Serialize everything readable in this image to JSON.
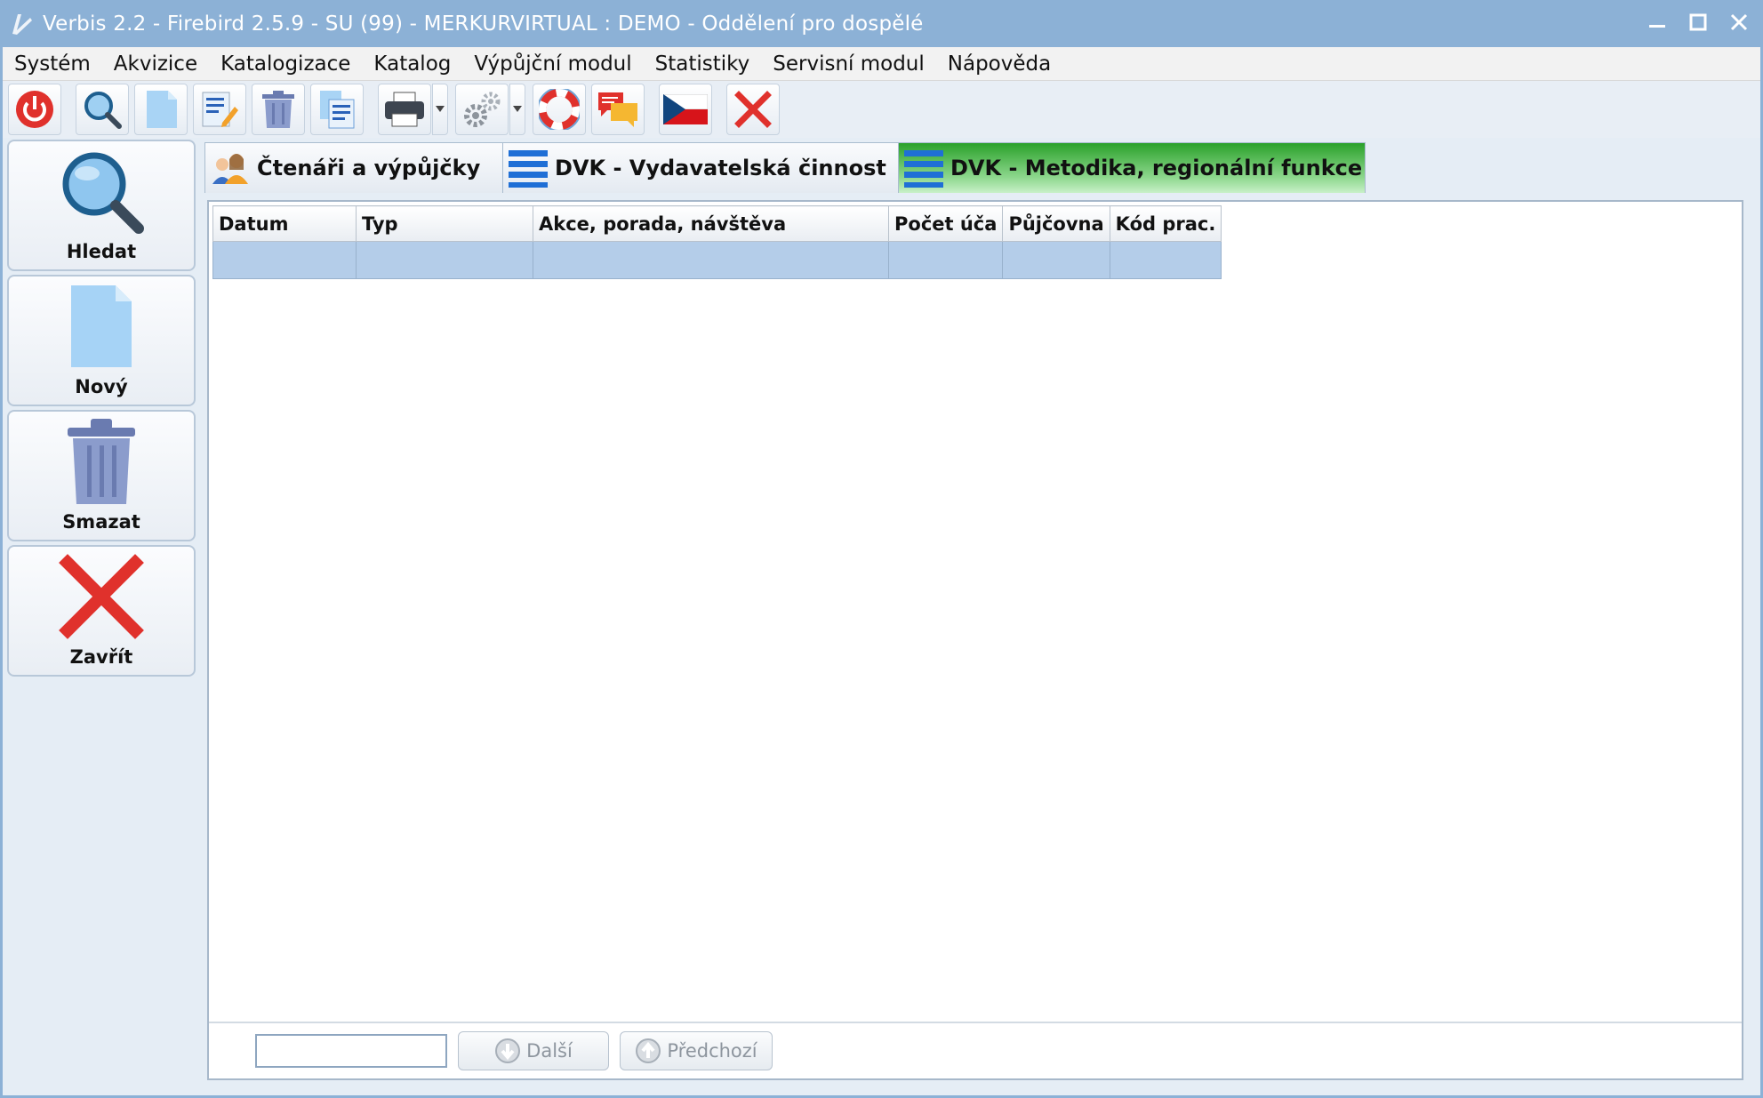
{
  "window": {
    "title": "Verbis 2.2 - Firebird 2.5.9 - SU (99) - MERKURVIRTUAL : DEMO - Oddělení pro dospělé"
  },
  "menu": {
    "items": [
      "Systém",
      "Akvizice",
      "Katalogizace",
      "Katalog",
      "Výpůjční modul",
      "Statistiky",
      "Servisní modul",
      "Nápověda"
    ]
  },
  "toolbar": {
    "icons": [
      "power-icon",
      "search-icon",
      "new-document-icon",
      "edit-document-icon",
      "trash-icon",
      "copy-document-icon",
      "printer-icon",
      "settings-gears-icon",
      "lifebuoy-icon",
      "chat-bubbles-icon",
      "czech-flag-icon",
      "close-icon"
    ]
  },
  "sidebar": {
    "items": [
      {
        "label": "Hledat"
      },
      {
        "label": "Nový"
      },
      {
        "label": "Smazat"
      },
      {
        "label": "Zavřít"
      }
    ]
  },
  "tabs": [
    {
      "label": "Čtenáři a výpůjčky",
      "active": false
    },
    {
      "label": "DVK - Vydavatelská činnost",
      "active": false
    },
    {
      "label": "DVK - Metodika, regionální funkce",
      "active": true
    }
  ],
  "table": {
    "columns": [
      "Datum",
      "Typ",
      "Akce, porada, návštěva",
      "Počet úča",
      "Půjčovna",
      "Kód prac."
    ],
    "rows": [
      [
        "",
        "",
        "",
        "",
        "",
        ""
      ]
    ]
  },
  "search": {
    "value": "",
    "next_label": "Další",
    "prev_label": "Předchozí"
  },
  "colors": {
    "titlebar": "#8cb1d6",
    "active_tab": "#2aa12a",
    "selected_row": "#b4cde9",
    "close_red": "#e0312c"
  }
}
